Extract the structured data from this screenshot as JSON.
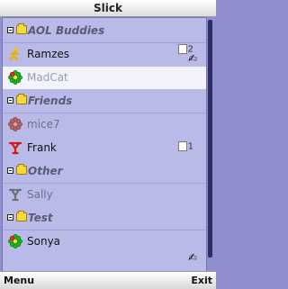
{
  "app": {
    "title": "Slick"
  },
  "groups": [
    {
      "name": "AOL Buddies"
    },
    {
      "name": "Friends"
    },
    {
      "name": "Other"
    },
    {
      "name": "Test"
    }
  ],
  "contacts": [
    {
      "name": "Ramzes",
      "icon": "aim-runner-icon",
      "badge": "2",
      "typing": "✍"
    },
    {
      "name": "MadCat",
      "icon": "icq-flower-icon",
      "selected": true
    },
    {
      "name": "mice7",
      "icon": "icq-flower-offline-icon"
    },
    {
      "name": "Frank",
      "icon": "yahoo-icon",
      "badge": "1"
    },
    {
      "name": "Sally",
      "icon": "yahoo-offline-icon"
    },
    {
      "name": "Sonya",
      "icon": "icq-flower-icon",
      "typing": "✍"
    }
  ],
  "colors": {
    "background": "#8f8fce",
    "list": "#babae8",
    "selected": "#f2f3fb",
    "scrollbar": "#2e2e66"
  },
  "softkeys": {
    "left": "Menu",
    "right": "Exit"
  }
}
